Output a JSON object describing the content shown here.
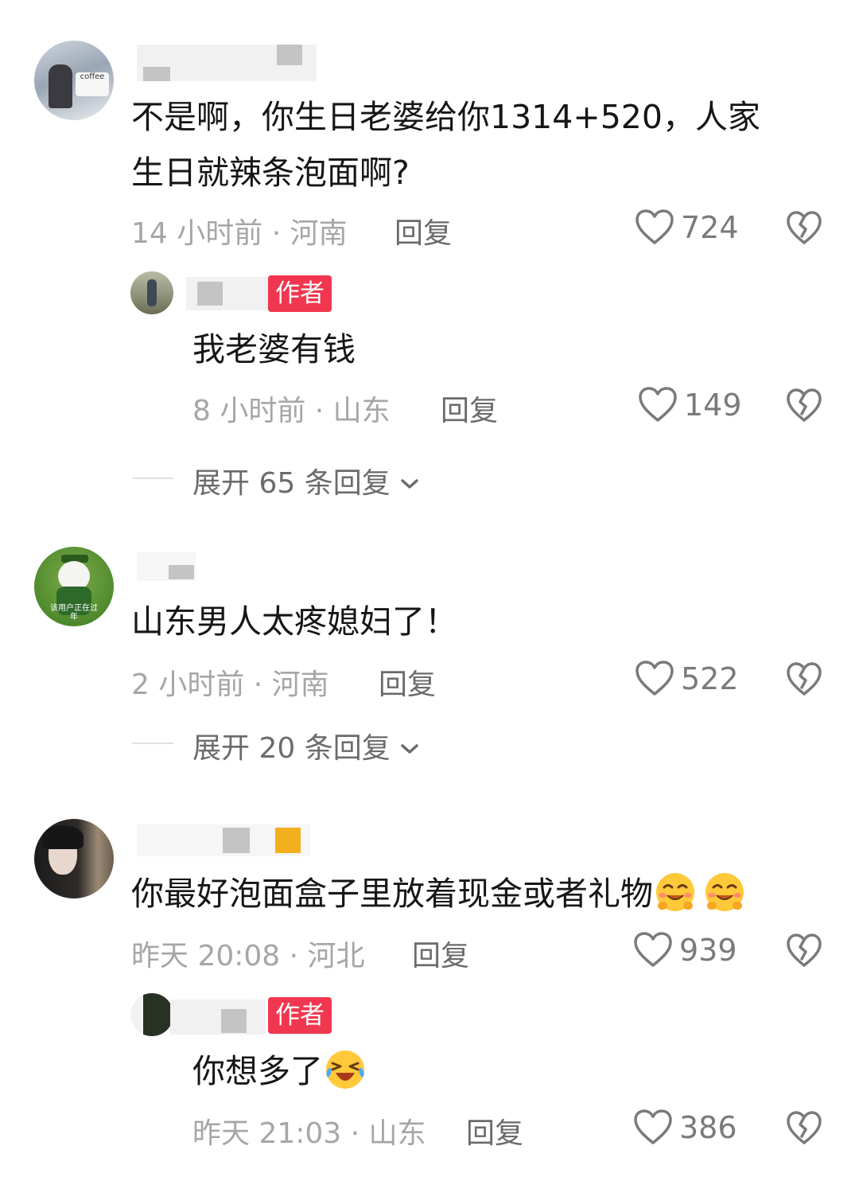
{
  "comments": [
    {
      "text_line1": "不是啊，你生日老婆给你1314+520，人家",
      "text_line2": "生日就辣条泡面啊?",
      "time_location": "14 小时前 · 河南",
      "reply_label": "回复",
      "likes": "724",
      "avatar_text": "coffee",
      "replies": [
        {
          "author_badge": "作者",
          "text": "我老婆有钱",
          "time_location": "8 小时前 · 山东",
          "reply_label": "回复",
          "likes": "149"
        }
      ],
      "expand_label": "展开 65 条回复"
    },
    {
      "text": "山东男人太疼媳妇了！",
      "time_location": "2 小时前 · 河南",
      "reply_label": "回复",
      "likes": "522",
      "avatar_text": "该用户正在过年",
      "expand_label": "展开 20 条回复"
    },
    {
      "text": "你最好泡面盒子里放着现金或者礼物",
      "emoji": [
        "blush-emoji",
        "blush-emoji"
      ],
      "time_location": "昨天 20:08 · 河北",
      "reply_label": "回复",
      "likes": "939",
      "replies": [
        {
          "author_badge": "作者",
          "text": "你想多了",
          "emoji": [
            "laugh-cry-emoji"
          ],
          "time_location": "昨天 21:03 · 山东",
          "reply_label": "回复",
          "likes": "386"
        }
      ]
    }
  ],
  "colors": {
    "badge": "#f1374f",
    "meta": "#a6a6a6",
    "text": "#161616",
    "icon": "#7a7a7a"
  }
}
